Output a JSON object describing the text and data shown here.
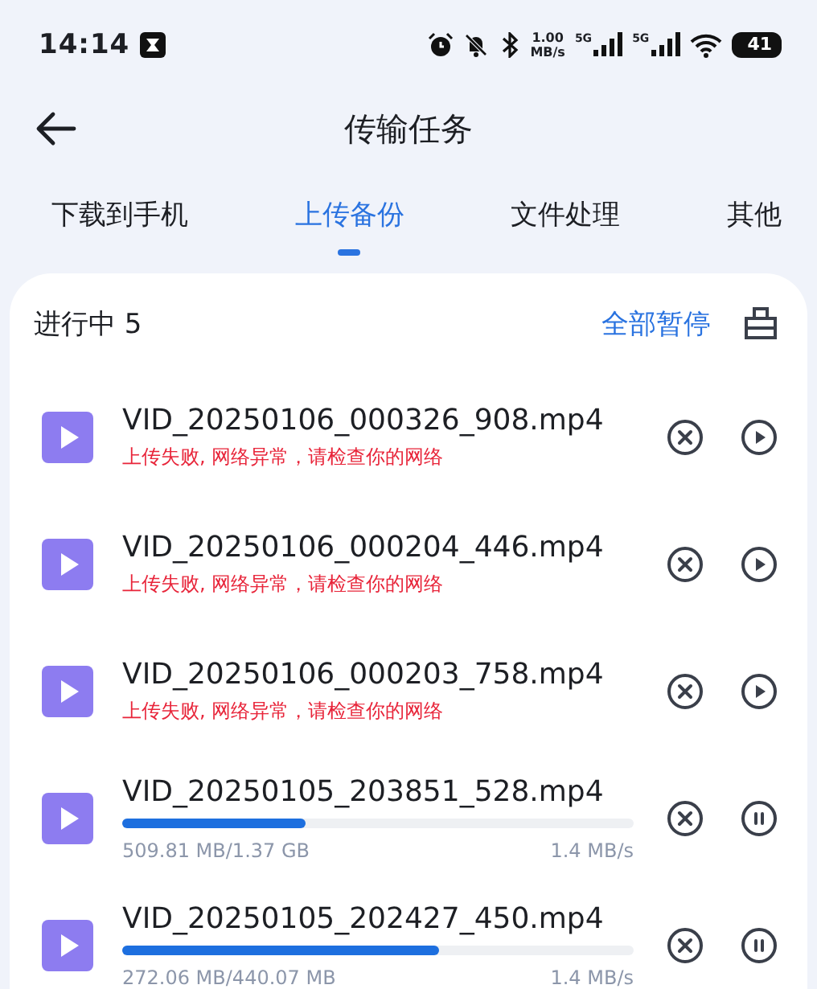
{
  "status_bar": {
    "time": "14:14",
    "net_speed_value": "1.00",
    "net_speed_unit": "MB/s",
    "signals": [
      "5G",
      "5G"
    ],
    "battery": "41"
  },
  "header": {
    "title": "传输任务"
  },
  "tabs": [
    {
      "label": "下载到手机",
      "selected": false
    },
    {
      "label": "上传备份",
      "selected": true
    },
    {
      "label": "文件处理",
      "selected": false
    },
    {
      "label": "其他",
      "selected": false
    }
  ],
  "section": {
    "title": "进行中 5",
    "action": "全部暂停"
  },
  "tasks": [
    {
      "kind": "failed",
      "name": "VID_20250106_000326_908.mp4",
      "message": "上传失败, 网络异常，请检查你的网络"
    },
    {
      "kind": "failed",
      "name": "VID_20250106_000204_446.mp4",
      "message": "上传失败, 网络异常，请检查你的网络"
    },
    {
      "kind": "failed",
      "name": "VID_20250106_000203_758.mp4",
      "message": "上传失败, 网络异常，请检查你的网络"
    },
    {
      "kind": "uploading",
      "name": "VID_20250105_203851_528.mp4",
      "level": 0.36,
      "size": "509.81 MB/1.37 GB",
      "speed": "1.4 MB/s"
    },
    {
      "kind": "uploading",
      "name": "VID_20250105_202427_450.mp4",
      "level": 0.62,
      "size": "272.06 MB/440.07 MB",
      "speed": "1.4 MB/s"
    }
  ]
}
